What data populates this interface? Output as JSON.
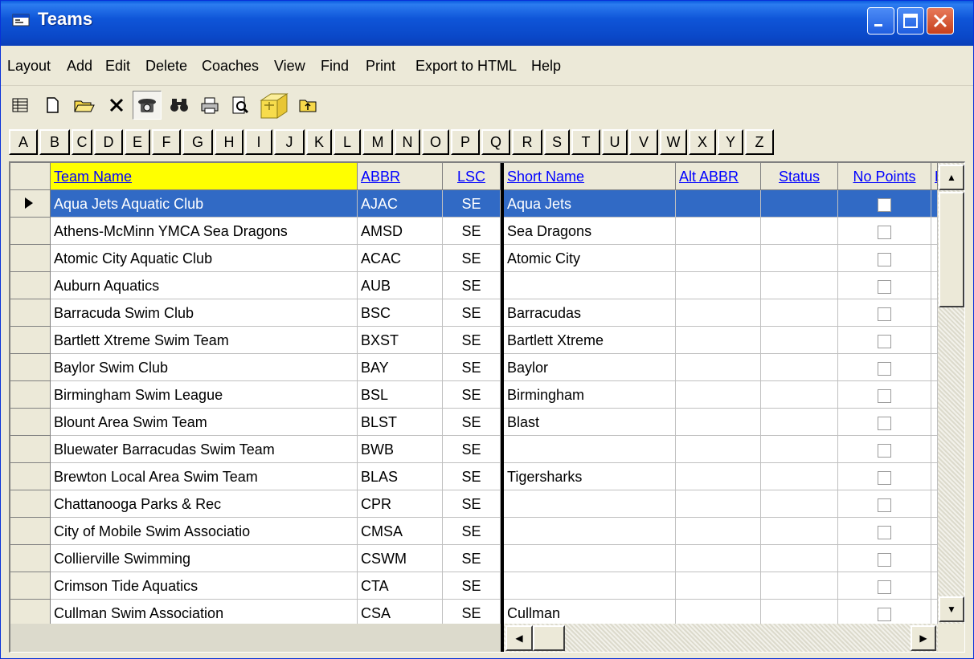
{
  "window": {
    "title": "Teams"
  },
  "menu": [
    "Layout",
    "Add",
    "Edit",
    "Delete",
    "Coaches",
    "View",
    "Find",
    "Print",
    "Export to HTML",
    "Help"
  ],
  "toolbar_icons": [
    "grid-view-icon",
    "new-document-icon",
    "open-folder-icon",
    "delete-x-icon",
    "telephone-icon",
    "binoculars-icon",
    "printer-icon",
    "print-preview-icon",
    "folder-arrow-icon",
    "up-folder-icon"
  ],
  "letters": [
    "A",
    "B",
    "C",
    "D",
    "E",
    "F",
    "G",
    "H",
    "I",
    "J",
    "K",
    "L",
    "M",
    "N",
    "O",
    "P",
    "Q",
    "R",
    "S",
    "T",
    "U",
    "V",
    "W",
    "X",
    "Y",
    "Z"
  ],
  "columns": {
    "team_name": "Team Name",
    "abbr": "ABBR",
    "lsc": "LSC",
    "short_name": "Short Name",
    "alt_abbr": "Alt ABBR",
    "status": "Status",
    "no_points": "No Points",
    "partial": "F"
  },
  "rows": [
    {
      "team_name": "Aqua Jets Aquatic Club",
      "abbr": "AJAC",
      "lsc": "SE",
      "short_name": "Aqua Jets",
      "alt_abbr": "",
      "status": "",
      "no_points": false,
      "selected": true
    },
    {
      "team_name": "Athens-McMinn YMCA Sea Dragons",
      "abbr": "AMSD",
      "lsc": "SE",
      "short_name": "Sea Dragons",
      "alt_abbr": "",
      "status": "",
      "no_points": false
    },
    {
      "team_name": "Atomic City Aquatic Club",
      "abbr": "ACAC",
      "lsc": "SE",
      "short_name": "Atomic City",
      "alt_abbr": "",
      "status": "",
      "no_points": false
    },
    {
      "team_name": "Auburn Aquatics",
      "abbr": "AUB",
      "lsc": "SE",
      "short_name": "",
      "alt_abbr": "",
      "status": "",
      "no_points": false
    },
    {
      "team_name": "Barracuda Swim Club",
      "abbr": "BSC",
      "lsc": "SE",
      "short_name": "Barracudas",
      "alt_abbr": "",
      "status": "",
      "no_points": false
    },
    {
      "team_name": "Bartlett Xtreme Swim Team",
      "abbr": "BXST",
      "lsc": "SE",
      "short_name": "Bartlett Xtreme",
      "alt_abbr": "",
      "status": "",
      "no_points": false
    },
    {
      "team_name": "Baylor Swim Club",
      "abbr": "BAY",
      "lsc": "SE",
      "short_name": "Baylor",
      "alt_abbr": "",
      "status": "",
      "no_points": false
    },
    {
      "team_name": "Birmingham Swim League",
      "abbr": "BSL",
      "lsc": "SE",
      "short_name": "Birmingham",
      "alt_abbr": "",
      "status": "",
      "no_points": false
    },
    {
      "team_name": "Blount Area Swim Team",
      "abbr": "BLST",
      "lsc": "SE",
      "short_name": "Blast",
      "alt_abbr": "",
      "status": "",
      "no_points": false
    },
    {
      "team_name": "Bluewater Barracudas Swim Team",
      "abbr": "BWB",
      "lsc": "SE",
      "short_name": "",
      "alt_abbr": "",
      "status": "",
      "no_points": false
    },
    {
      "team_name": "Brewton Local Area Swim Team",
      "abbr": "BLAS",
      "lsc": "SE",
      "short_name": "Tigersharks",
      "alt_abbr": "",
      "status": "",
      "no_points": false
    },
    {
      "team_name": "Chattanooga Parks & Rec",
      "abbr": "CPR",
      "lsc": "SE",
      "short_name": "",
      "alt_abbr": "",
      "status": "",
      "no_points": false
    },
    {
      "team_name": "City of Mobile Swim Associatio",
      "abbr": "CMSA",
      "lsc": "SE",
      "short_name": "",
      "alt_abbr": "",
      "status": "",
      "no_points": false
    },
    {
      "team_name": "Collierville Swimming",
      "abbr": "CSWM",
      "lsc": "SE",
      "short_name": "",
      "alt_abbr": "",
      "status": "",
      "no_points": false
    },
    {
      "team_name": "Crimson Tide Aquatics",
      "abbr": "CTA",
      "lsc": "SE",
      "short_name": "",
      "alt_abbr": "",
      "status": "",
      "no_points": false
    },
    {
      "team_name": "Cullman Swim Association",
      "abbr": "CSA",
      "lsc": "SE",
      "short_name": "Cullman",
      "alt_abbr": "",
      "status": "",
      "no_points": false
    }
  ],
  "colors": {
    "title_bar": "#0a48c8",
    "selected_row": "#316ac5",
    "sorted_header": "#ffff00",
    "header_link": "#0000ff"
  }
}
